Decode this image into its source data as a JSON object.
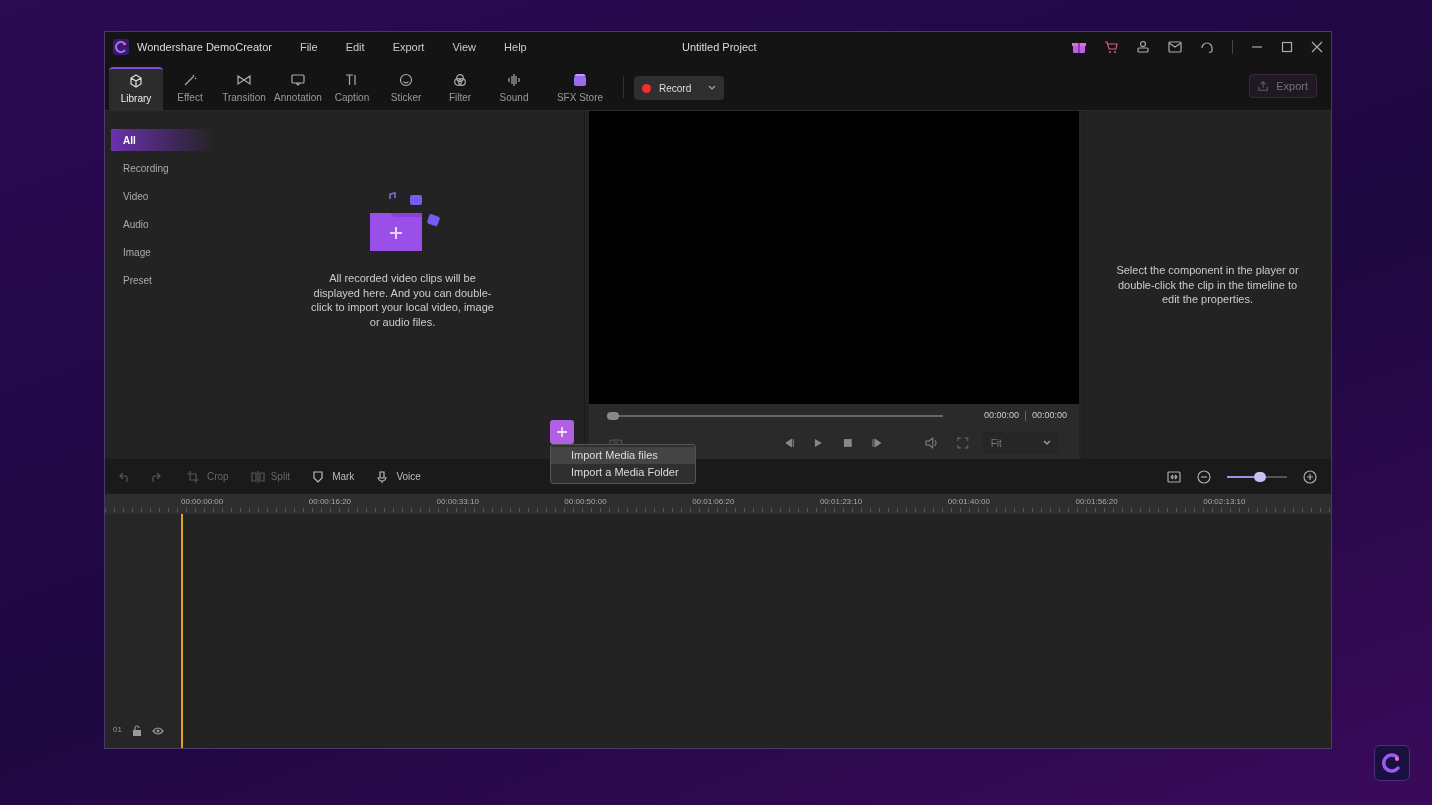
{
  "window": {
    "app_name": "Wondershare DemoCreator",
    "title": "Untitled Project"
  },
  "menu": [
    "File",
    "Edit",
    "Export",
    "View",
    "Help"
  ],
  "toolbar_tabs": [
    {
      "label": "Library",
      "selected": true
    },
    {
      "label": "Effect",
      "selected": false
    },
    {
      "label": "Transition",
      "selected": false
    },
    {
      "label": "Annotation",
      "selected": false
    },
    {
      "label": "Caption",
      "selected": false
    },
    {
      "label": "Sticker",
      "selected": false
    },
    {
      "label": "Filter",
      "selected": false
    },
    {
      "label": "Sound",
      "selected": false
    },
    {
      "label": "SFX Store",
      "selected": false
    }
  ],
  "record_button": {
    "label": "Record"
  },
  "export_button": {
    "label": "Export",
    "disabled": true
  },
  "library": {
    "categories": [
      {
        "label": "All",
        "selected": true
      },
      {
        "label": "Recording",
        "selected": false
      },
      {
        "label": "Video",
        "selected": false
      },
      {
        "label": "Audio",
        "selected": false
      },
      {
        "label": "Image",
        "selected": false
      },
      {
        "label": "Preset",
        "selected": false
      }
    ],
    "empty_message": "All recorded video clips will be displayed here. And you can double-click to import your local video, image or audio files."
  },
  "import_menu": {
    "items": [
      {
        "label": "Import Media files",
        "selected": true
      },
      {
        "label": "Import a Media Folder",
        "selected": false
      }
    ]
  },
  "player": {
    "level": 0,
    "current_time": "00:00:00",
    "total_time": "00:00:00",
    "fit": "Fit"
  },
  "properties": {
    "hint": "Select the component in the player or double-click the clip in the timeline to edit the properties."
  },
  "timeline_tools": [
    {
      "label": "Crop",
      "disabled": true
    },
    {
      "label": "Split",
      "disabled": true
    },
    {
      "label": "Mark",
      "disabled": false
    },
    {
      "label": "Voice",
      "disabled": false
    }
  ],
  "timeline_zoom": {
    "level": 0.55
  },
  "ruler": [
    "00:00:00:00",
    "00:00:16:20",
    "00:00:33:10",
    "00:00:50:00",
    "00:01:06:20",
    "00:01:23:10",
    "00:01:40:00",
    "00:01:56:20",
    "00:02:13:10"
  ],
  "track": {
    "number": "01"
  }
}
